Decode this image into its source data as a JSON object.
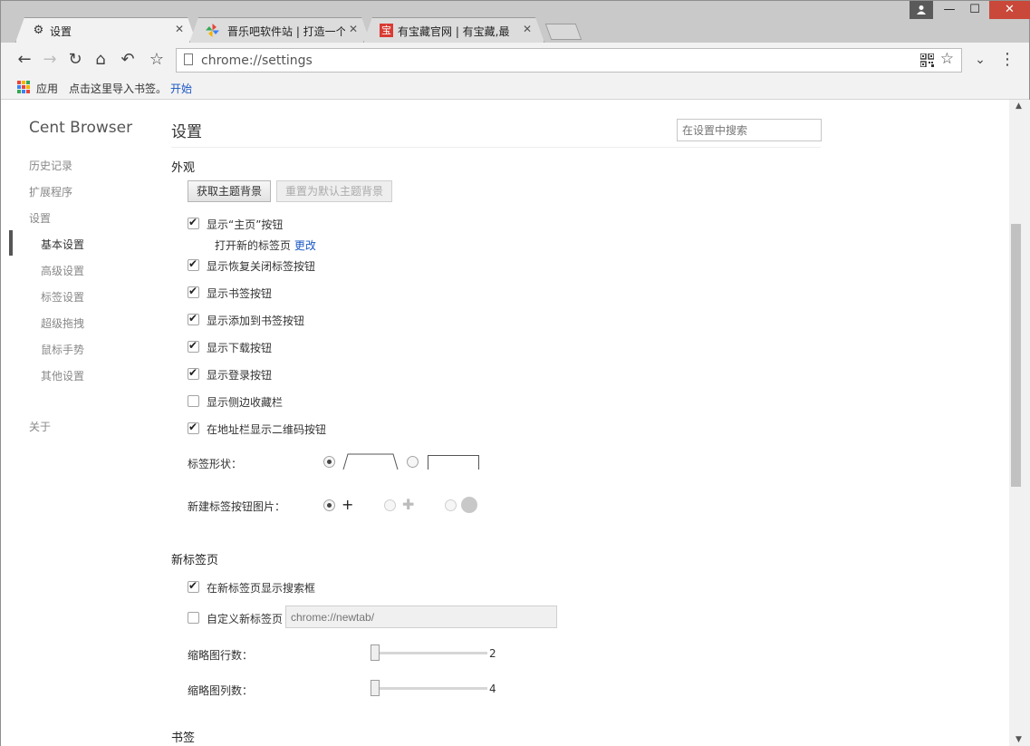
{
  "browser": {
    "tabs": [
      {
        "title": "设置",
        "favicon": "gear-icon",
        "active": true
      },
      {
        "title": "晋乐吧软件站 | 打造一个",
        "favicon": "pinwheel-icon",
        "active": false
      },
      {
        "title": "有宝藏官网 | 有宝藏,最",
        "favicon": "bao-icon",
        "favicon_text": "宝",
        "active": false
      }
    ],
    "url": "chrome://settings",
    "bookmarks": {
      "apps_label": "应用",
      "import_text": "点击这里导入书签。",
      "start_link": "开始"
    }
  },
  "sidebar": {
    "brand": "Cent Browser",
    "items": [
      {
        "label": "历史记录"
      },
      {
        "label": "扩展程序"
      },
      {
        "label": "设置"
      },
      {
        "label": "基本设置",
        "selected": true
      },
      {
        "label": "高级设置"
      },
      {
        "label": "标签设置"
      },
      {
        "label": "超级拖拽"
      },
      {
        "label": "鼠标手势"
      },
      {
        "label": "其他设置"
      },
      {
        "label": "关于"
      }
    ]
  },
  "main": {
    "title": "设置",
    "search_placeholder": "在设置中搜索",
    "appearance": {
      "title": "外观",
      "get_theme_button": "获取主题背景",
      "reset_theme_button": "重置为默认主题背景",
      "options": [
        {
          "label": "显示“主页”按钮",
          "checked": true
        },
        {
          "label": "显示恢复关闭标签按钮",
          "checked": true
        },
        {
          "label": "显示书签按钮",
          "checked": true
        },
        {
          "label": "显示添加到书签按钮",
          "checked": true
        },
        {
          "label": "显示下载按钮",
          "checked": true
        },
        {
          "label": "显示登录按钮",
          "checked": true
        },
        {
          "label": "显示侧边收藏栏",
          "checked": false
        },
        {
          "label": "在地址栏显示二维码按钮",
          "checked": true
        }
      ],
      "home_sub_text": "打开新的标签页",
      "home_change_link": "更改",
      "tab_shape_label": "标签形状：",
      "new_tab_button_label": "新建标签按钮图片："
    },
    "new_tab_page": {
      "title": "新标签页",
      "show_search_box": {
        "label": "在新标签页显示搜索框",
        "checked": true
      },
      "custom_page": {
        "label": "自定义新标签页",
        "checked": false,
        "placeholder": "chrome://newtab/"
      },
      "thumb_rows_label": "缩略图行数：",
      "thumb_rows_value": "2",
      "thumb_cols_label": "缩略图列数：",
      "thumb_cols_value": "4"
    },
    "bookmarks_title": "书签"
  }
}
